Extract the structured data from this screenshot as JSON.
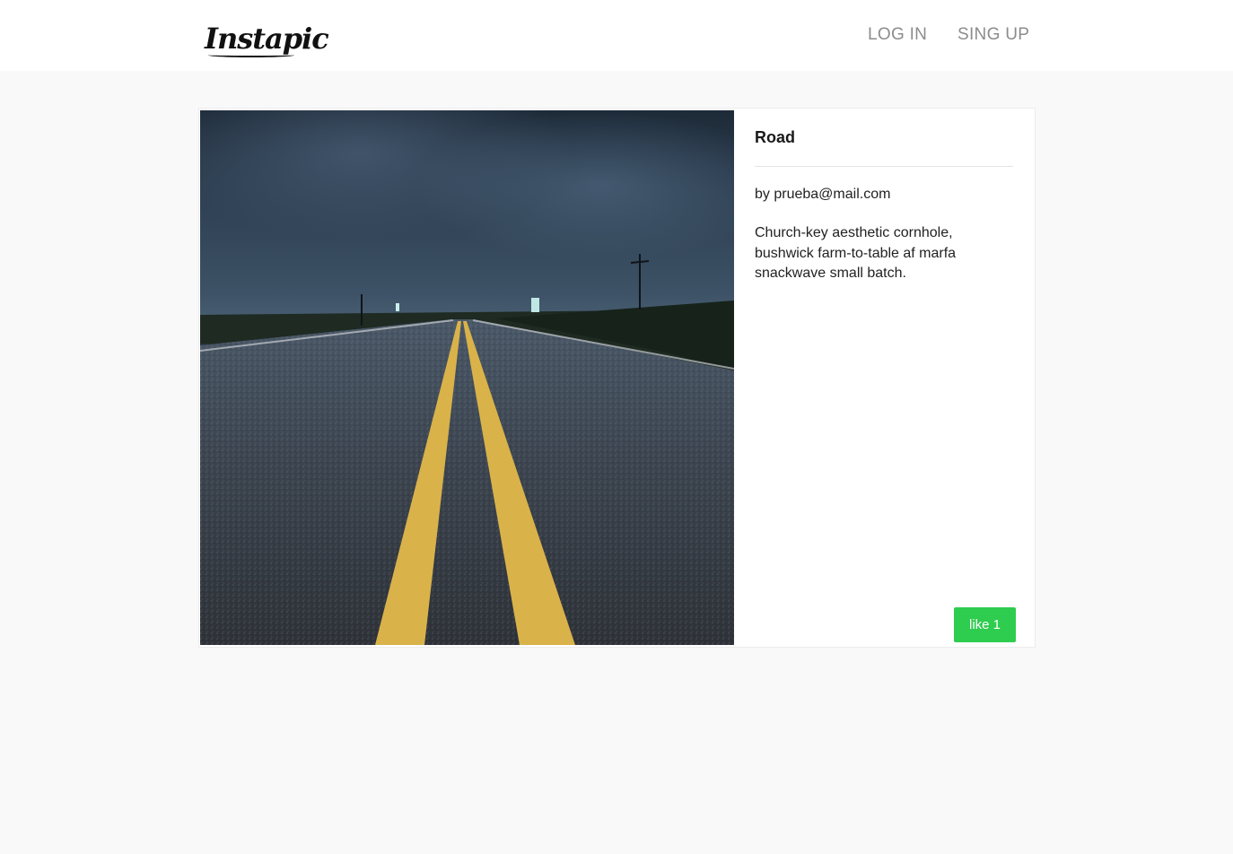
{
  "app": {
    "logo_text": "Instapic"
  },
  "nav": {
    "login_label": "LOG IN",
    "signup_label": "SING UP"
  },
  "post": {
    "title": "Road",
    "author": "by prueba@mail.com",
    "description": "Church-key aesthetic cornhole, bushwick farm-to-table af marfa snackwave small batch.",
    "like_label": "like 1",
    "like_count": 1,
    "image_subject": "night-road-photo"
  },
  "colors": {
    "background": "#f9f9f9",
    "navbar": "#ffffff",
    "nav_text": "#8c8c8c",
    "like_button": "#2ecc4f",
    "card_border": "#ececec"
  }
}
